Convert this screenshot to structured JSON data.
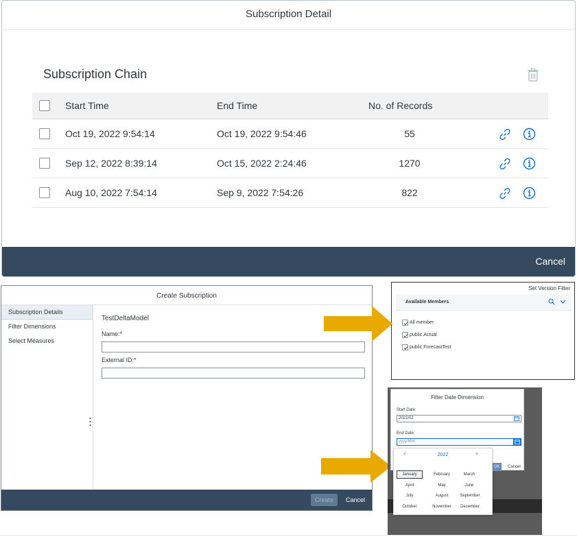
{
  "subscription_detail": {
    "title": "Subscription Detail",
    "chain_title": "Subscription Chain",
    "columns": [
      "Start Time",
      "End Time",
      "No. of Records"
    ],
    "rows": [
      {
        "start": "Oct 19, 2022 9:54:14",
        "end": "Oct 19, 2022 9:54:46",
        "records": "55"
      },
      {
        "start": "Sep 12, 2022 8:39:14",
        "end": "Oct 15, 2022 2:24:46",
        "records": "1270"
      },
      {
        "start": "Aug 10, 2022 7:54:14",
        "end": "Sep 9, 2022 7:54:26",
        "records": "822"
      }
    ],
    "cancel_label": "Cancel",
    "footer_color": "#354a5f"
  },
  "create_subscription": {
    "title": "Create Subscription",
    "nav": [
      "Subscription Details",
      "Filter Dimensions",
      "Select Measures"
    ],
    "model_name": "TestDeltaModel",
    "name_label": "Name:",
    "external_id_label": "External ID:",
    "required_mark": "*",
    "name_value": "",
    "external_id_value": "",
    "create_label": "Create",
    "cancel_label": "Cancel"
  },
  "version_filter": {
    "title": "Set Version Filter",
    "available_members": "Available Members",
    "items": [
      {
        "label": "All member",
        "checked": true
      },
      {
        "label": "public.Actual",
        "checked": true
      },
      {
        "label": "public.ForecastTest",
        "checked": true
      }
    ]
  },
  "date_filter": {
    "title": "Filter Date Dimension",
    "start_label": "Start Date:",
    "start_value": "2022/02",
    "end_label": "End Date:",
    "end_placeholder": "yyyy/MM",
    "ok_label": "OK",
    "cancel_label": "Cancel",
    "picker": {
      "prev": "<",
      "next": ">",
      "year": "2022",
      "months": [
        "January",
        "February",
        "March",
        "April",
        "May",
        "June",
        "July",
        "August",
        "September",
        "October",
        "November",
        "December"
      ],
      "selected": "January"
    }
  },
  "colors": {
    "arrow": "#e8a900",
    "accent": "#0a6ed1"
  }
}
